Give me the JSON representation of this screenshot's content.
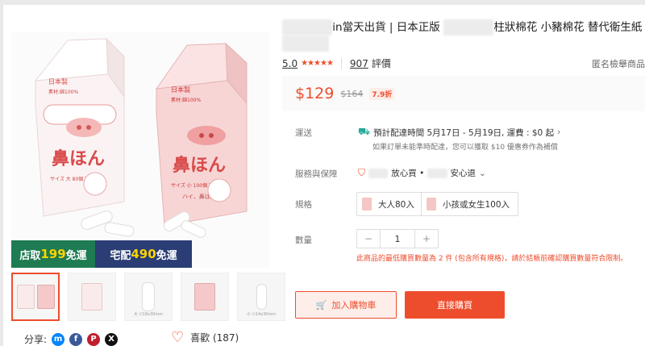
{
  "product": {
    "title_prefix": "██████",
    "title_part1": "in當天出貨 | 日本正版 ",
    "title_blur2": "██████",
    "title_part2": "柱狀棉花 小豬棉花 替代衛生紙",
    "title_line2_blur": "【███】"
  },
  "rating": {
    "score": "5.0",
    "stars": "★★★★★",
    "count": "907",
    "count_label": "評價",
    "report": "匿名檢舉商品"
  },
  "price": {
    "current": "$129",
    "original": "$164",
    "discount": "7.9折"
  },
  "shipping": {
    "label": "運送",
    "line1": "預計配達時間 5月17日 - 5月19日, 運費 : $0 起",
    "line2": "如果訂單未能準時配達，您可以獲取 $10 優惠券作為補償"
  },
  "service": {
    "label": "服務與保障",
    "text_blur1": "███",
    "text1": "放心買 •",
    "text_blur2": "███",
    "text2": "安心退"
  },
  "variants": {
    "label": "規格",
    "options": [
      "大人80入",
      "小孩或女生100入"
    ]
  },
  "quantity": {
    "label": "數量",
    "minus": "−",
    "value": "1",
    "plus": "+",
    "warning": "此商品的最低購買數量為 2 件 (包含所有規格)，請於結帳前確認購買數量符合限制。"
  },
  "buttons": {
    "cart": "加入購物車",
    "buy": "直接購買"
  },
  "promo": {
    "store_pre": "店取",
    "store_amt": "199",
    "store_post": "免運",
    "home_pre": "宅配",
    "home_amt": "490",
    "home_post": "免運"
  },
  "product_image": {
    "box1_top": "日本製",
    "box1_sub": "素材:綿100%",
    "box1_brand": "鼻ほん",
    "box1_size": "サイズ 大 80個入",
    "box2_top": "日本製",
    "box2_sub": "素材:綿100%",
    "box2_brand": "鼻ほん",
    "box2_size": "サイズ 小 100個入",
    "speech": "ハイ、鼻ほんっ！"
  },
  "thumb_captions": [
    "",
    "",
    "大 ∅18x30mm",
    "",
    "小 ∅14x30mm"
  ],
  "share": {
    "label": "分享:",
    "like": "喜歡 (187)"
  },
  "colors": {
    "accent": "#ee4d2d",
    "store_green": "#1e7b52",
    "home_navy": "#2a3d74",
    "highlight": "#ffd400"
  }
}
